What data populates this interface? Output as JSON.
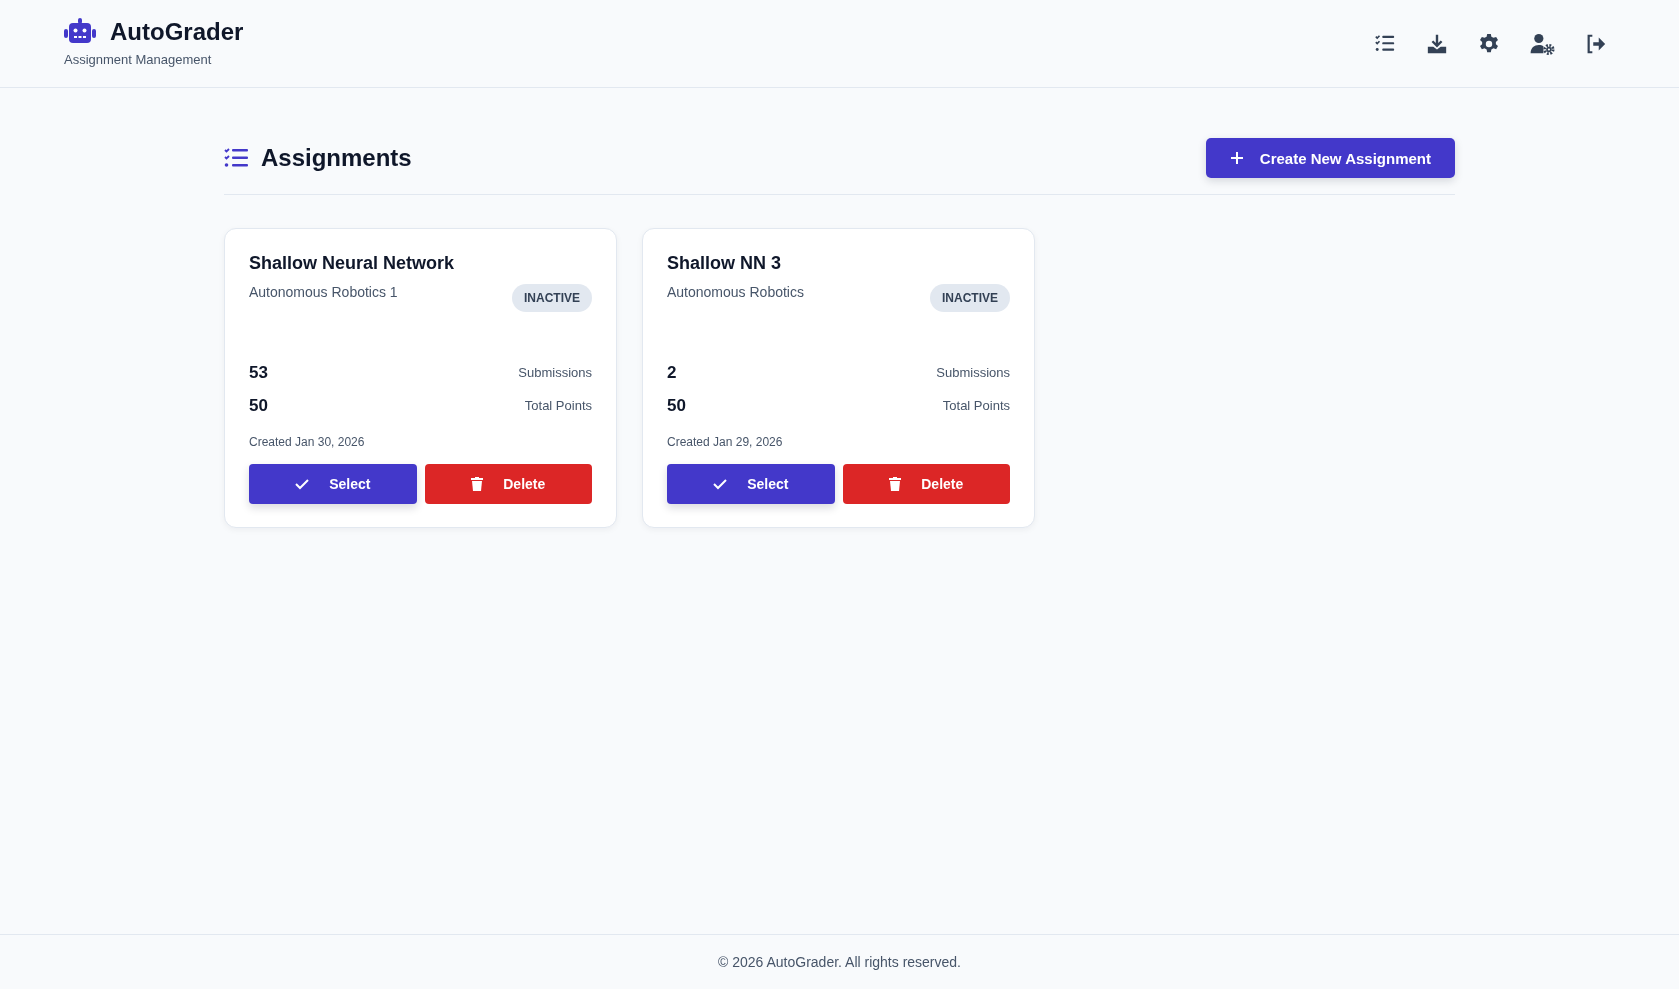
{
  "app": {
    "name": "AutoGrader",
    "subtitle": "Assignment Management"
  },
  "page": {
    "title": "Assignments",
    "create_button": "Create New Assignment"
  },
  "assignments": [
    {
      "title": "Shallow Neural Network",
      "course": "Autonomous Robotics 1",
      "status": {
        "text": "INACTIVE",
        "active": false
      },
      "submissions": "53",
      "submissions_label": "Submissions",
      "points": "50",
      "points_label": "Total Points",
      "created": "Created Jan 30, 2026",
      "select_label": "Select",
      "delete_label": "Delete"
    },
    {
      "title": "Shallow NN 3",
      "course": "Autonomous Robotics",
      "status": {
        "text": "INACTIVE",
        "active": false
      },
      "submissions": "2",
      "submissions_label": "Submissions",
      "points": "50",
      "points_label": "Total Points",
      "created": "Created Jan 29, 2026",
      "select_label": "Select",
      "delete_label": "Delete"
    }
  ],
  "footer": "© 2026 AutoGrader. All rights reserved."
}
